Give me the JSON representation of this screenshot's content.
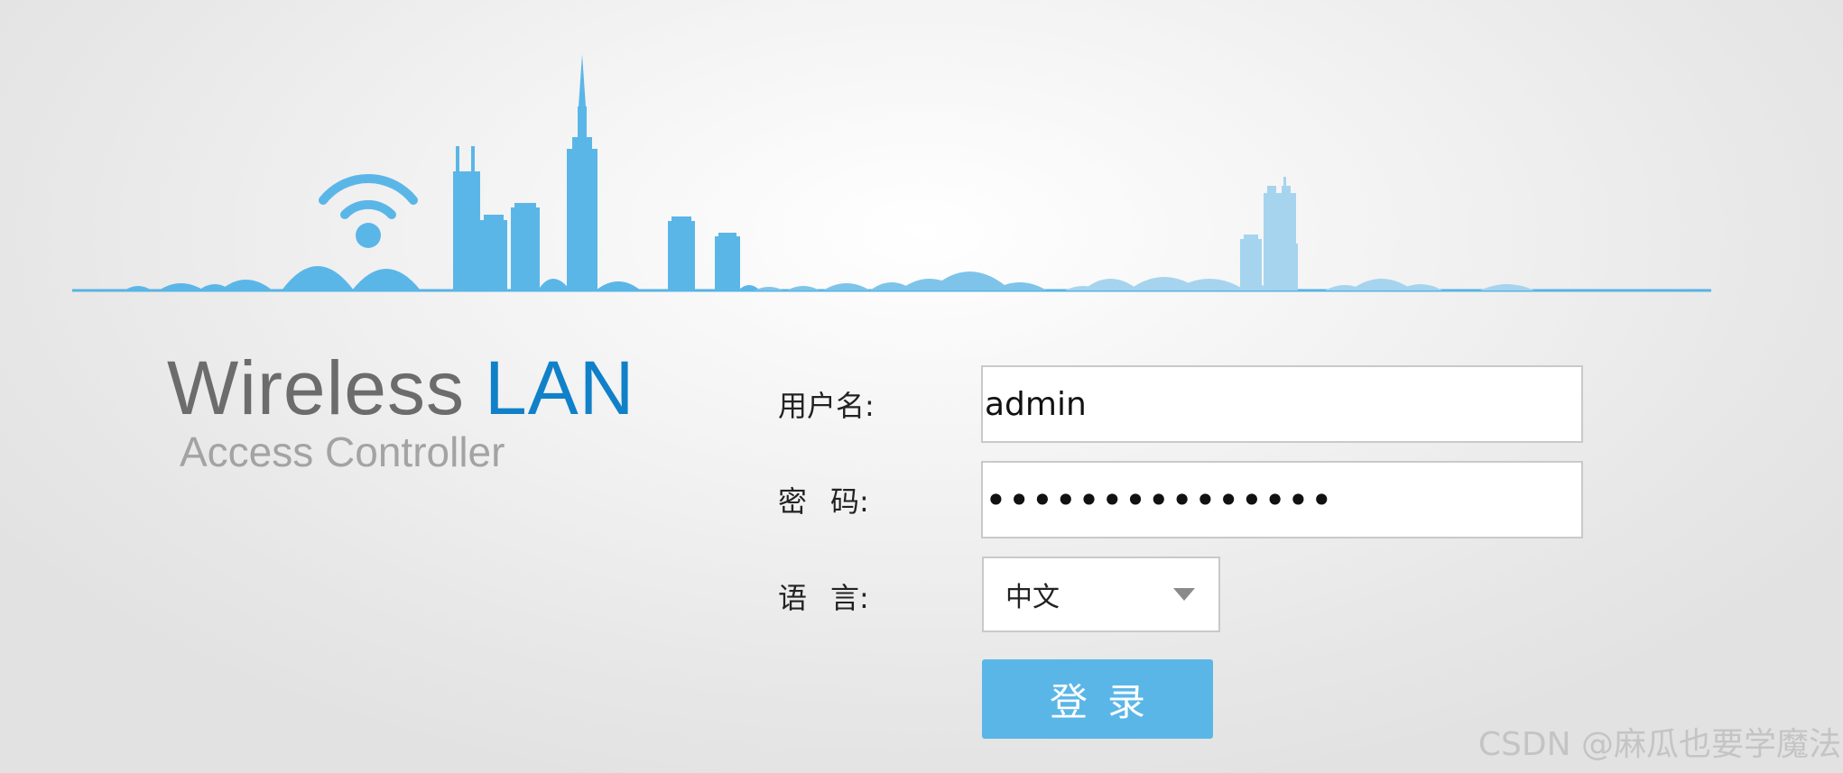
{
  "brand": {
    "title_word1": "Wireless",
    "title_word2": "LAN",
    "subtitle": "Access Controller"
  },
  "form": {
    "username_label": "用户名:",
    "username_value": "admin",
    "password_label_char1": "密",
    "password_label_char2": "码:",
    "password_value": "•••••••••••••••",
    "language_label_char1": "语",
    "language_label_char2": "言:",
    "language_selected": "中文",
    "login_button": "登录"
  },
  "watermark": "CSDN @麻瓜也要学魔法",
  "icons": {
    "wifi": "wifi-icon",
    "skyline": "city-skyline-banner",
    "dropdown": "triangle-down"
  },
  "colors": {
    "brand_gray": "#6c6c6c",
    "brand_blue": "#1081c8",
    "subtitle_gray": "#a3a3a3",
    "skyline_blue": "#5bb6e8",
    "skyline_light": "#a6d4ef",
    "button_blue": "#5bb6e8"
  }
}
